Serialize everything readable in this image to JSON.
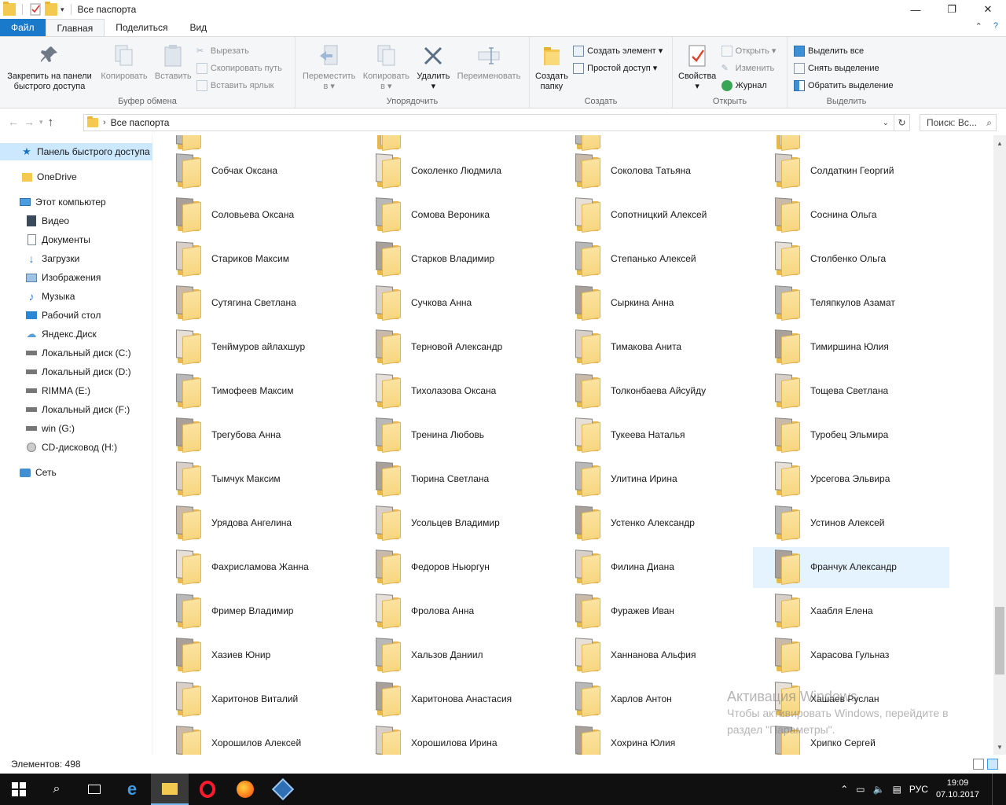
{
  "window": {
    "title": "Все паспорта",
    "controls": {
      "minimize": "—",
      "maximize": "❐",
      "close": "✕"
    }
  },
  "tabs": [
    {
      "label": "Файл"
    },
    {
      "label": "Главная"
    },
    {
      "label": "Поделиться"
    },
    {
      "label": "Вид"
    }
  ],
  "ribbon": {
    "clipboard": {
      "group_label": "Буфер обмена",
      "pin": "Закрепить на панели быстрого доступа",
      "pin_line1": "Закрепить на панели",
      "pin_line2": "быстрого доступа",
      "copy": "Копировать",
      "paste": "Вставить",
      "cut": "Вырезать",
      "copy_path": "Скопировать путь",
      "paste_shortcut": "Вставить ярлык"
    },
    "organize": {
      "group_label": "Упорядочить",
      "move_to": "Переместить",
      "move_to_sub": "в ▾",
      "copy_to": "Копировать",
      "copy_to_sub": "в ▾",
      "delete": "Удалить",
      "delete_sub": "▾",
      "rename": "Переименовать"
    },
    "create": {
      "group_label": "Создать",
      "new_folder_line1": "Создать",
      "new_folder_line2": "папку",
      "new_item": "Создать элемент ▾",
      "easy_access": "Простой доступ ▾"
    },
    "open": {
      "group_label": "Открыть",
      "properties": "Свойства",
      "properties_sub": "▾",
      "open": "Открыть ▾",
      "edit": "Изменить",
      "history": "Журнал"
    },
    "select": {
      "group_label": "Выделить",
      "select_all": "Выделить все",
      "select_none": "Снять выделение",
      "invert": "Обратить выделение"
    }
  },
  "address": {
    "path": "Все паспорта",
    "search_placeholder": "Поиск: Вс..."
  },
  "navpane": {
    "items": [
      {
        "label": "Панель быстрого доступа",
        "icon": "star-icon"
      },
      {
        "label": "OneDrive",
        "icon": "folder-icon"
      },
      {
        "label": "Этот компьютер",
        "icon": "computer-icon"
      },
      {
        "label": "Видео",
        "icon": "video-icon"
      },
      {
        "label": "Документы",
        "icon": "documents-icon"
      },
      {
        "label": "Загрузки",
        "icon": "download-icon"
      },
      {
        "label": "Изображения",
        "icon": "pictures-icon"
      },
      {
        "label": "Музыка",
        "icon": "music-icon"
      },
      {
        "label": "Рабочий стол",
        "icon": "desktop-icon"
      },
      {
        "label": "Яндекс.Диск",
        "icon": "cloud-icon"
      },
      {
        "label": "Локальный диск (C:)",
        "icon": "drive-icon"
      },
      {
        "label": "Локальный диск (D:)",
        "icon": "drive-icon"
      },
      {
        "label": "RIMMA (E:)",
        "icon": "drive-icon"
      },
      {
        "label": "Локальный диск (F:)",
        "icon": "drive-icon"
      },
      {
        "label": "win (G:)",
        "icon": "drive-icon"
      },
      {
        "label": "CD-дисковод (H:)",
        "icon": "cd-icon"
      },
      {
        "label": "Сеть",
        "icon": "network-icon"
      }
    ]
  },
  "folders": [
    "Собчак Оксана",
    "Соколенко Людмила",
    "Соколова Татьяна",
    "Солдаткин Георгий",
    "Соловьева Оксана",
    "Сомова Вероника",
    "Сопотницкий Алексей",
    "Соснина Ольга",
    "Стариков Максим",
    "Старков Владимир",
    "Степанько Алексей",
    "Столбенко Ольга",
    "Сутягина Светлана",
    "Сучкова Анна",
    "Сыркина Анна",
    "Теляпкулов Азамат",
    "Тенймуров айлахшур",
    "Терновой Александр",
    "Тимакова Анита",
    "Тимиршина Юлия",
    "Тимофеев Максим",
    "Тихолазова Оксана",
    "Толконбаева Айсуйду",
    "Тощева Светлана",
    "Трегубова Анна",
    "Тренина Любовь",
    "Тукеева Наталья",
    "Туробец Эльмира",
    "Тымчук Максим",
    "Тюрина Светлана",
    "Улитина Ирина",
    "Урсегова Эльвира",
    "Урядова Ангелина",
    "Усольцев Владимир",
    "Устенко Александр",
    "Устинов Алексей",
    "Фахрисламова Жанна",
    "Федоров Ньюргун",
    "Филина Диана",
    "Франчук Александр",
    "Фример Владимир",
    "Фролова Анна",
    "Фуражев Иван",
    "Хаабля Елена",
    "Хазиев Юнир",
    "Хальзов Даниил",
    "Ханнанова Альфия",
    "Харасова Гульназ",
    "Харитонов Виталий",
    "Харитонова Анастасия",
    "Харлов Антон",
    "Хашаев Руслан",
    "Хорошилов Алексей",
    "Хорошилова Ирина",
    "Хохрина Юлия",
    "Хрипко Сергей"
  ],
  "selected_folder": "Франчук Александр",
  "status": {
    "items_count": "Элементов: 498"
  },
  "watermark": {
    "title": "Активация Windows",
    "line1": "Чтобы активировать Windows, перейдите в",
    "line2": "раздел \"Параметры\"."
  },
  "taskbar": {
    "tray_lang": "РУС",
    "time": "19:09",
    "date": "07.10.2017"
  }
}
